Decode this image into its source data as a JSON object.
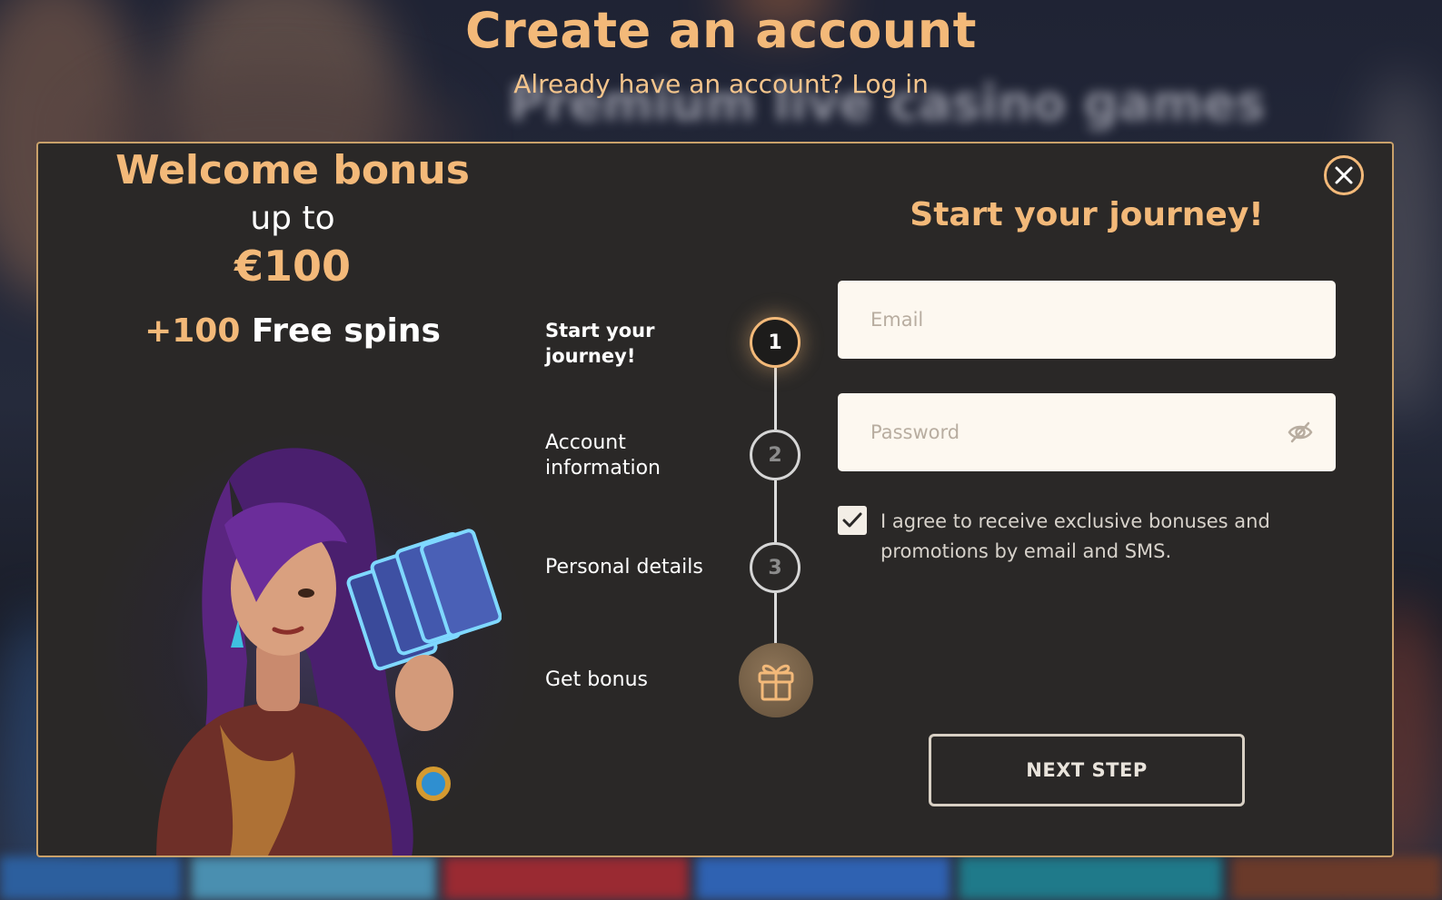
{
  "header": {
    "title": "Create an account",
    "login_prompt": "Already have an account?",
    "login_link": "Log in",
    "background_text": "Premium live casino games"
  },
  "promo": {
    "title": "Welcome bonus",
    "up_to": "up to",
    "amount": "€100",
    "spins_count": "+100",
    "spins_label": "Free spins"
  },
  "steps": [
    {
      "label": "Start your journey!",
      "number": "1",
      "state": "active"
    },
    {
      "label": "Account information",
      "number": "2",
      "state": "pending"
    },
    {
      "label": "Personal details",
      "number": "3",
      "state": "pending"
    },
    {
      "label": "Get bonus",
      "icon": "gift-icon",
      "state": "pending"
    }
  ],
  "form": {
    "title": "Start your journey!",
    "email_placeholder": "Email",
    "password_placeholder": "Password",
    "consent_text": "I agree to receive exclusive bonuses and promotions by email and SMS.",
    "consent_checked": true,
    "next_label": "NEXT STEP"
  },
  "colors": {
    "accent": "#f3b979",
    "modal_bg": "#2a2827",
    "field_bg": "#fdf8f0"
  }
}
